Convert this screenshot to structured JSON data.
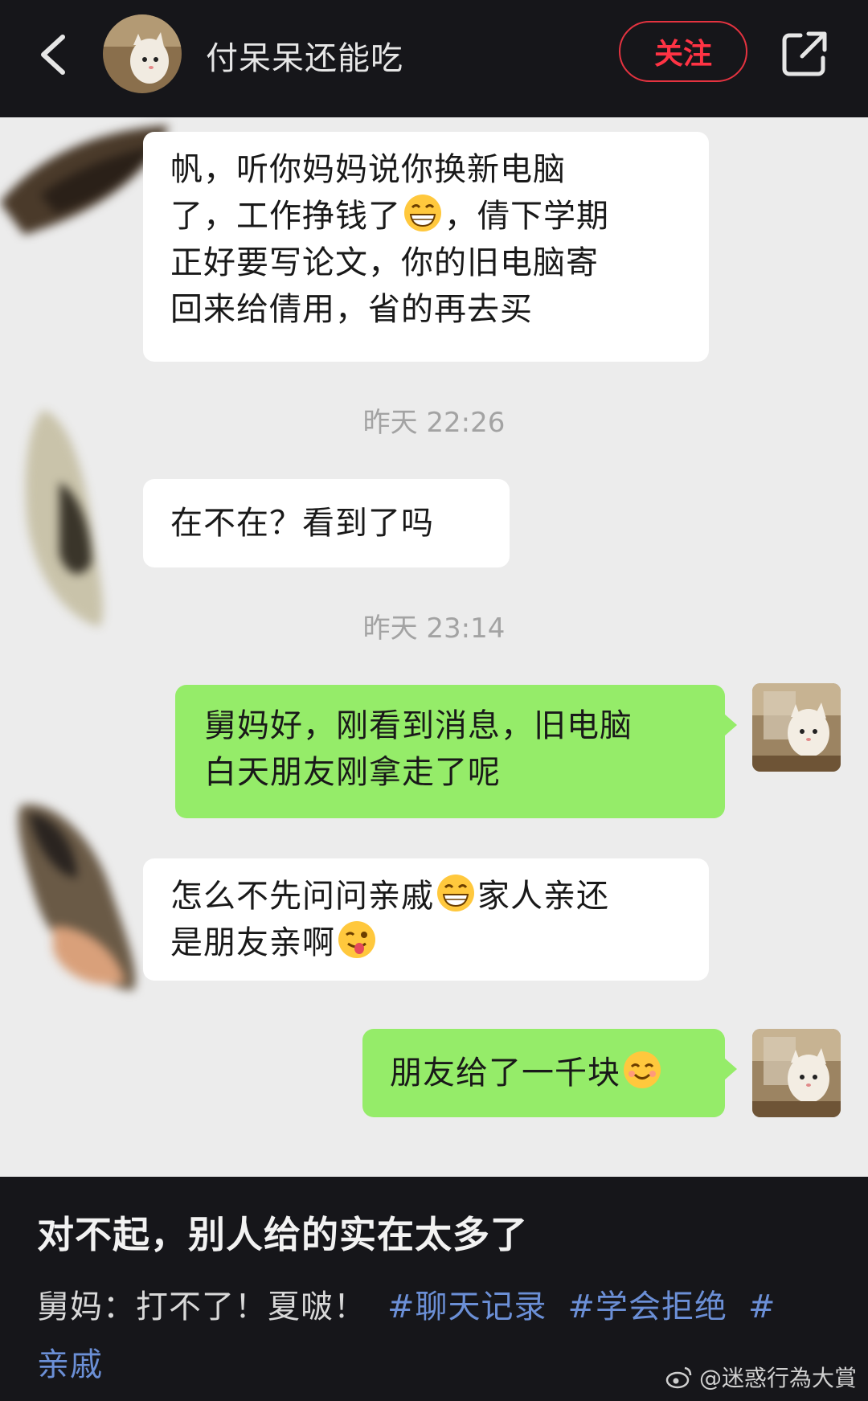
{
  "header": {
    "title": "付呆呆还能吃",
    "follow_label": "关注",
    "icons": [
      "back-icon",
      "share-icon"
    ],
    "accent_color": "#e53340"
  },
  "chat": {
    "messages": [
      {
        "side": "in",
        "lines": [
          "帆，听你妈妈说你换新电脑",
          "了，工作挣钱了",
          "，倩下学期",
          "正好要写论文，你的旧电脑寄",
          "回来给倩用，省的再去买"
        ]
      },
      {
        "timestamp": "昨天 22:26"
      },
      {
        "side": "in",
        "text": "在不在？看到了吗"
      },
      {
        "timestamp": "昨天 23:14"
      },
      {
        "side": "out",
        "lines": [
          "舅妈好，刚看到消息，旧电脑",
          "白天朋友刚拿走了呢"
        ]
      },
      {
        "side": "in",
        "lines": [
          "怎么不先问问亲戚",
          "家人亲还",
          "是朋友亲啊"
        ]
      },
      {
        "side": "out",
        "text": "朋友给了一千块"
      }
    ],
    "colors": {
      "incoming": "#ffffff",
      "outgoing": "#95ec69",
      "background": "#ececec"
    }
  },
  "footer": {
    "caption": "对不起，别人给的实在太多了",
    "description": "舅妈：打不了！夏啵！",
    "tags": [
      "#聊天记录",
      "#学会拒绝",
      "#"
    ],
    "tag_wrap": "亲戚",
    "watermark": "@迷惑行為大賞"
  }
}
